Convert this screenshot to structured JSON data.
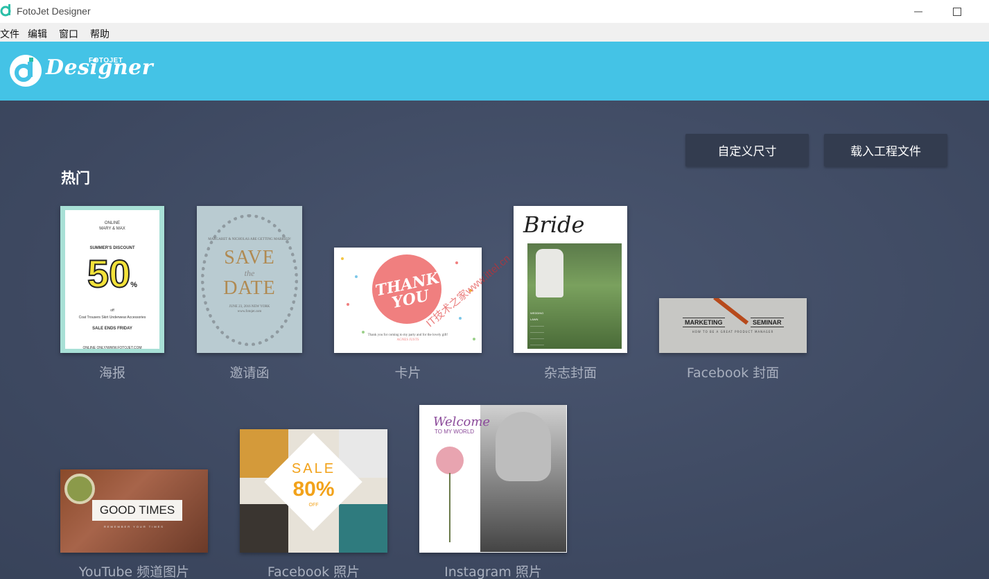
{
  "window": {
    "title": "FotoJet Designer",
    "minimize_icon": "minimize-icon",
    "maximize_icon": "maximize-icon"
  },
  "menu": {
    "items": [
      "文件",
      "编辑",
      "窗口",
      "帮助"
    ]
  },
  "header": {
    "logo_text": "Designer",
    "logo_small": "FOTOJET",
    "accent_color": "#44c3e6"
  },
  "toolbar": {
    "custom_size_label": "自定义尺寸",
    "load_project_label": "载入工程文件"
  },
  "section": {
    "title": "热门"
  },
  "templates": [
    {
      "caption": "海报",
      "preview": {
        "line1": "ONLINE",
        "line2": "MARY & MAX",
        "line3": "SUMMER'S DISCOUNT",
        "big": "50",
        "pct": "%",
        "off": "off",
        "categories": "Coat  Trousers  Skirt  Underwear  Accessories",
        "line4": "SALE ENDS FRIDAY",
        "url": "ONLINE ONLY/WWW.FOTOJET.COM"
      }
    },
    {
      "caption": "邀请函",
      "preview": {
        "names": "MARGARET & NICHOLAS\nARE GETTING MARRIED!",
        "save": "SAVE",
        "the": "the",
        "date": "DATE",
        "when": "JUNE 23, 2016  NEW YORK",
        "site": "www.fotojet.com"
      }
    },
    {
      "caption": "卡片",
      "preview": {
        "thank": "THANK",
        "you": "YOU",
        "note": "Thank you for coming to my party and for the lovely gift!",
        "sign": "AGNES JUSTS"
      }
    },
    {
      "caption": "杂志封面",
      "preview": {
        "title": "Bride",
        "sidebar1": "LAWN",
        "sidebar_lines": [
          "WEDDING",
          "LAWN",
          "—————",
          "—————",
          "—————",
          "—————"
        ]
      }
    },
    {
      "caption": "Facebook 封面",
      "preview": {
        "left_label": "MARKETING",
        "right_label": "SEMINAR",
        "sub": "HOW TO BE A GREAT PRODUCT MANAGER"
      }
    },
    {
      "caption": "YouTube 频道图片",
      "preview": {
        "headline": "GOOD TIMES",
        "tag": "REMEMBER YOUR TIMES"
      }
    },
    {
      "caption": "Facebook 照片",
      "preview": {
        "sale": "SALE",
        "pct": "80%",
        "off": "OFF"
      }
    },
    {
      "caption": "Instagram 照片",
      "preview": {
        "welcome": "Welcome",
        "to_my_world": "TO MY WORLD"
      }
    }
  ],
  "watermark": "IT技术之家www.ittel.cn",
  "colors": {
    "titlebar": "#ffffff",
    "menubar": "#f0f0f0",
    "header": "#44c3e6",
    "content_bg": "#3e4a61",
    "button_bg": "#333c4f",
    "caption": "#a9b0bf"
  }
}
